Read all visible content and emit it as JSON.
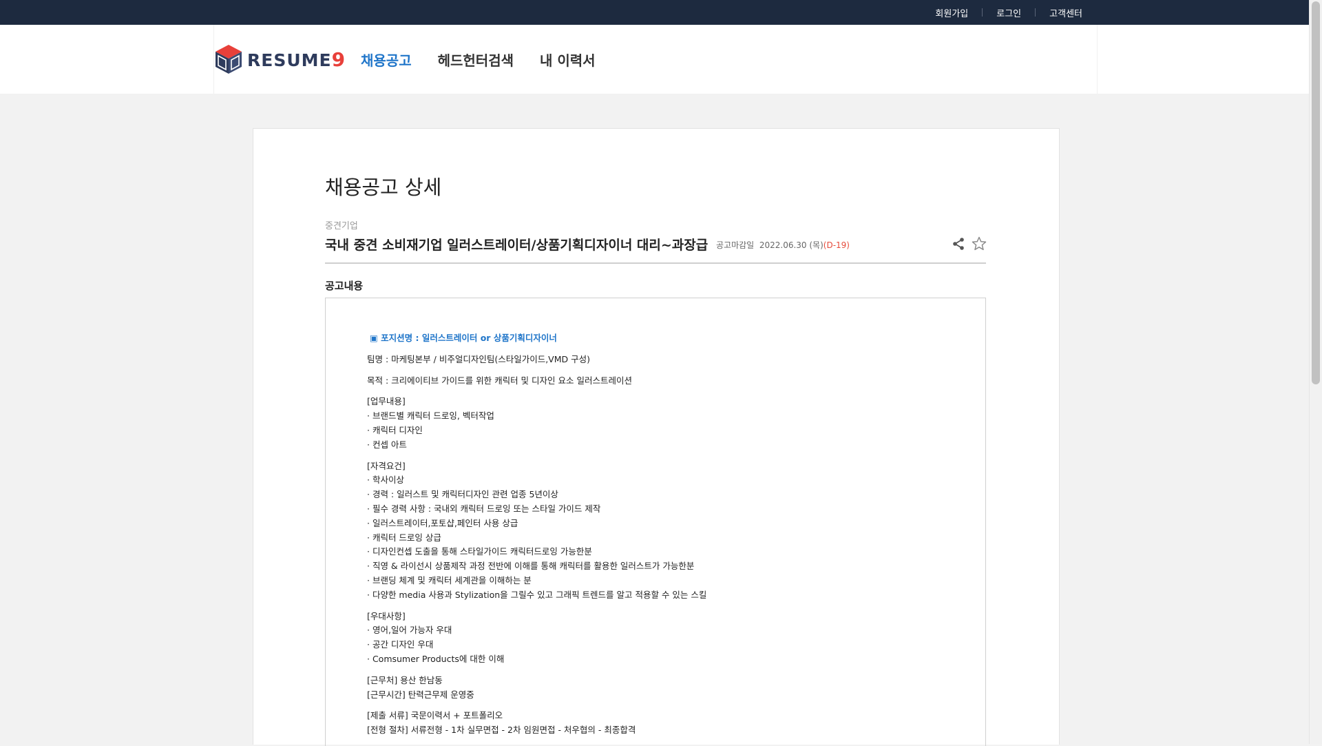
{
  "topbar": {
    "links": [
      "회원가입",
      "로그인",
      "고객센터"
    ]
  },
  "header": {
    "logo_text": "RESUME",
    "logo_nine": "9",
    "nav": [
      "채용공고",
      "헤드헌터검색",
      "내 이력서"
    ]
  },
  "page": {
    "title": "채용공고 상세",
    "company": "중견기업",
    "job_title": "국내 중견 소비재기업 일러스트레이터/상품기획디자이너 대리~과장급",
    "deadline_label": "공고마감일",
    "deadline_date": "2022.06.30 (목)",
    "dday": "(D-19)",
    "section_label": "공고내용"
  },
  "content": {
    "position": "▣ 포지션명 : 일러스트레이터 or 상품기획디자이너",
    "team": "팀명 : 마케팅본부 / 비주얼디자인팀(스타일가이드,VMD 구성)",
    "purpose": "목적 : 크리에이티브 가이드를 위한 캐릭터 및 디자인 요소 일러스트레이션",
    "duties": [
      "[업무내용]",
      "· 브랜드별 캐릭터 드로잉, 벡터작업",
      "· 캐릭터 디자인",
      "· 컨셉 아트"
    ],
    "requirements": [
      "[자격요건]",
      "· 학사이상",
      "· 경력 : 일러스트 및 캐릭터디자인 관련 업종 5년이상",
      "· 필수 경력 사항 : 국내외 캐릭터 드로잉 또는 스타일 가이드 제작",
      "· 일러스트레이터,포토샵,페인터 사용 상급",
      "· 캐릭터 드로잉 상급",
      "· 디자인컨셉 도출을 통해 스타일가이드 캐릭터드로잉 가능한분",
      "· 직영 & 라이선시 상품제작 과정 전반에 이해를 통해 캐릭터를 활용한 일러스트가 가능한분",
      "· 브랜딩 체계 및 캐릭터 세계관을 이해하는 분",
      "· 다양한 media 사용과 Stylization을 그릴수 있고 그래픽 트렌드를 알고 적용할 수 있는 스킬"
    ],
    "preferred": [
      "[우대사항]",
      "· 영어,일어 가능자 우대",
      "· 공간 디자인 우대",
      "· Comsumer Products에 대한 이해"
    ],
    "work_info": [
      "[근무처] 용산 한남동",
      "[근무시간] 탄력근무제 운영중"
    ],
    "process": [
      "[제출 서류] 국문이력서 + 포트폴리오",
      "[전형 절차] 서류전형 - 1차 실무면접 - 2차 임원면접 - 처우협의 - 최종합격"
    ]
  },
  "icons": {
    "share": "share-icon",
    "bookmark": "star-icon"
  },
  "colors": {
    "topbar": "#1d2a3f",
    "accent_blue": "#1f75c9",
    "dday_red": "#e64b3b"
  }
}
